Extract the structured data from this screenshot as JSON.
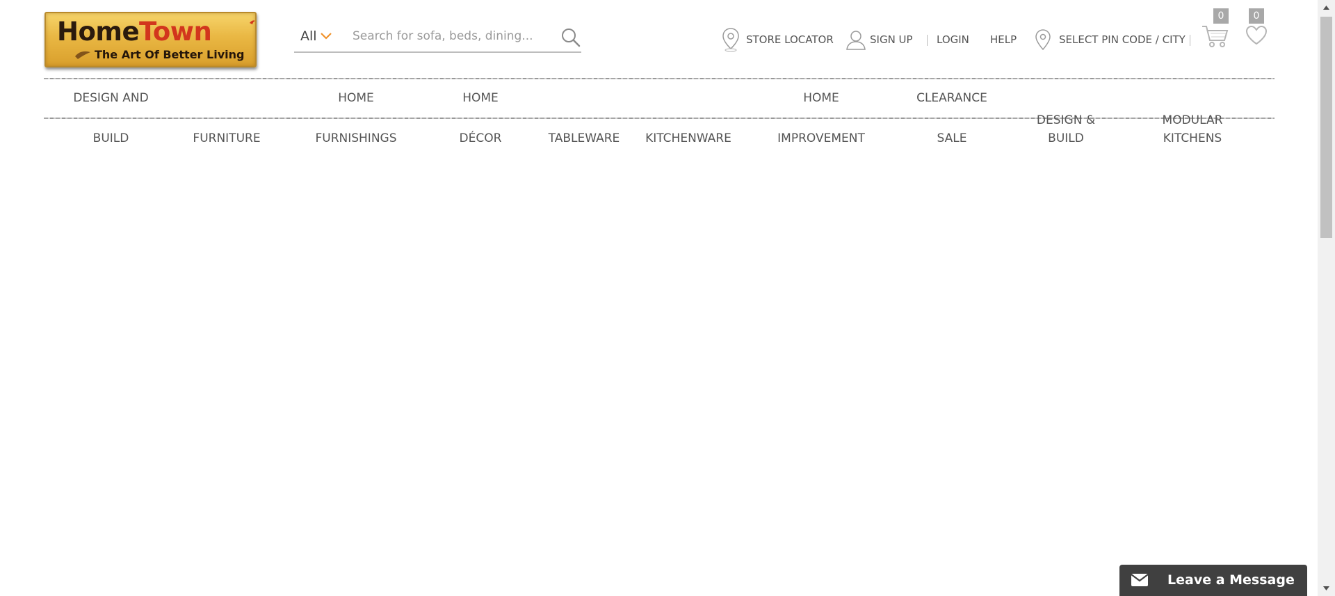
{
  "logo": {
    "brand_part1": "Home",
    "brand_part2": "Town",
    "tagline": "The Art Of Better Living"
  },
  "search": {
    "category": "All",
    "placeholder": "Search for sofa, beds, dining..."
  },
  "top_links": {
    "store_locator": "STORE LOCATOR",
    "sign_up": "SIGN UP",
    "login": "LOGIN",
    "help": "HELP",
    "pin_code": "SELECT PIN CODE / CITY"
  },
  "cart": {
    "count": "0"
  },
  "wishlist": {
    "count": "0"
  },
  "nav": [
    {
      "line1": "DESIGN AND",
      "line2": "BUILD"
    },
    {
      "line1": "",
      "line2": "FURNITURE"
    },
    {
      "line1": "HOME",
      "line2": "FURNISHINGS"
    },
    {
      "line1": "HOME",
      "line2": "DÉCOR"
    },
    {
      "line1": "",
      "line2": "TABLEWARE"
    },
    {
      "line1": "",
      "line2": "KITCHENWARE"
    },
    {
      "line1": "HOME",
      "line2": "IMPROVEMENT"
    },
    {
      "line1": "CLEARANCE",
      "line2": "SALE"
    },
    {
      "line1": "DESIGN &",
      "line2": "BUILD"
    },
    {
      "line1": "MODULAR",
      "line2": "KITCHENS"
    }
  ],
  "chat": {
    "label": "Leave a Message"
  },
  "colors": {
    "accent": "#f0922b",
    "logo_red": "#d2361d",
    "chat_bg": "#404040",
    "text": "#555555"
  },
  "icons": [
    "search-icon",
    "chevron-down-icon",
    "map-pin-icon",
    "user-icon",
    "cart-icon",
    "heart-icon",
    "envelope-icon"
  ]
}
